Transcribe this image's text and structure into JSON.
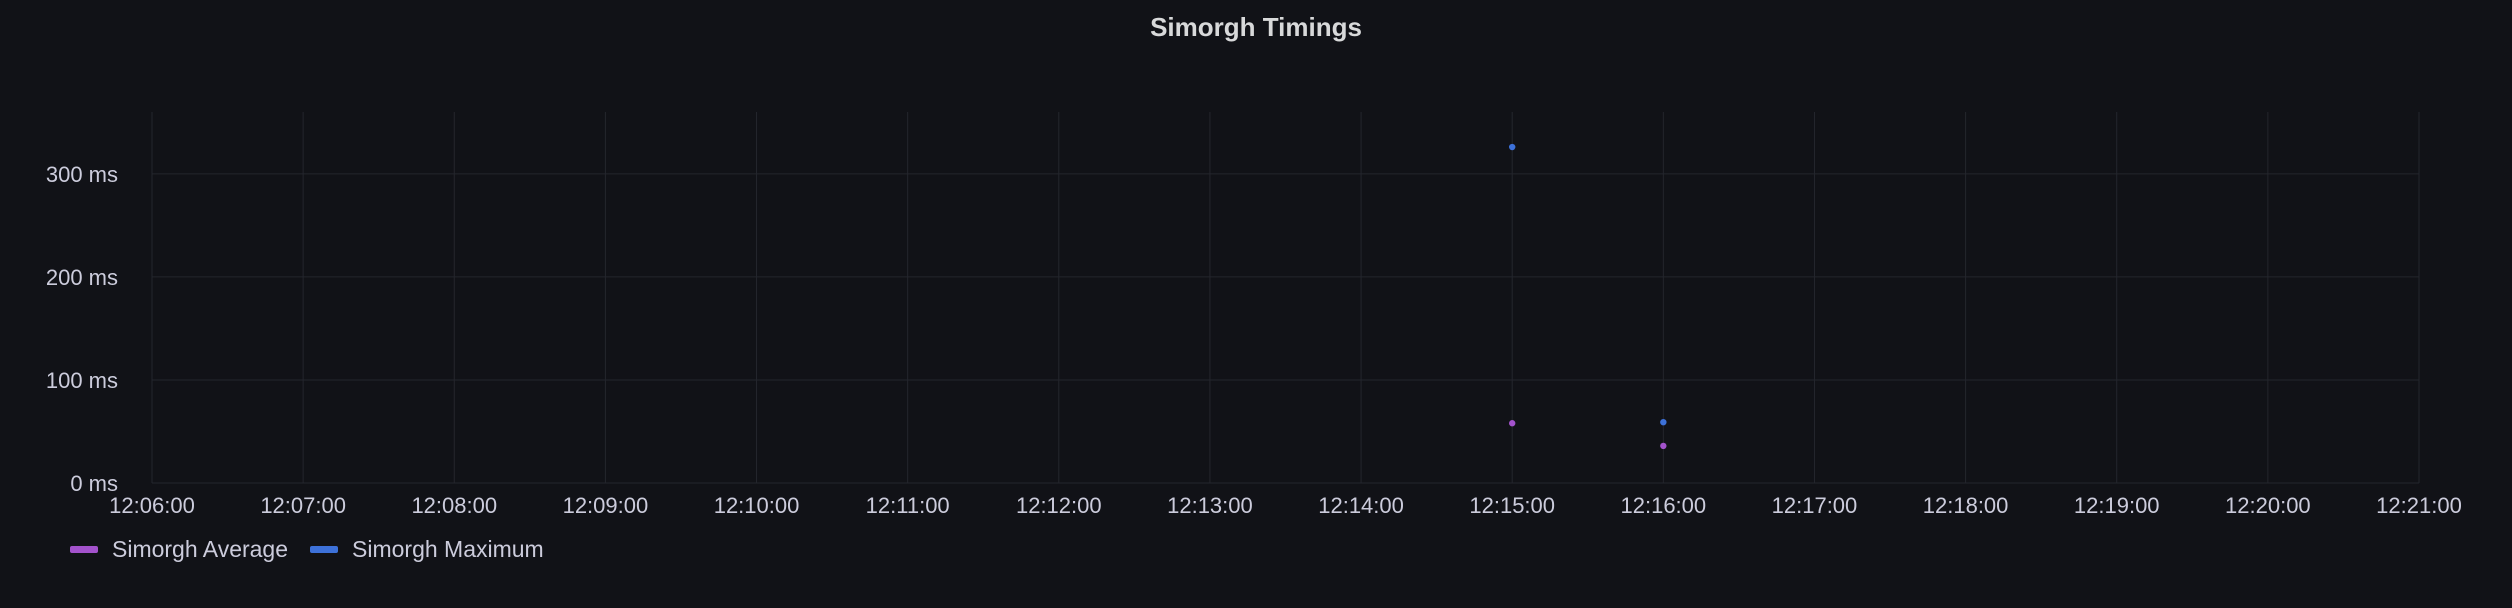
{
  "panel": {
    "title": "Simorgh Timings"
  },
  "chart_data": {
    "type": "scatter",
    "title": "Simorgh Timings",
    "xlabel": "",
    "ylabel": "",
    "x_ticks": [
      "12:06:00",
      "12:07:00",
      "12:08:00",
      "12:09:00",
      "12:10:00",
      "12:11:00",
      "12:12:00",
      "12:13:00",
      "12:14:00",
      "12:15:00",
      "12:16:00",
      "12:17:00",
      "12:18:00",
      "12:19:00",
      "12:20:00",
      "12:21:00"
    ],
    "xlim": [
      "12:06:00",
      "12:21:00"
    ],
    "y_ticks": [
      0,
      100,
      200,
      300
    ],
    "y_tick_labels": [
      "0 ms",
      "100 ms",
      "200 ms",
      "300 ms"
    ],
    "ylim": [
      0,
      360
    ],
    "y_unit": "ms",
    "grid": true,
    "legend_position": "bottom-left",
    "series": [
      {
        "name": "Simorgh Average",
        "color": "#a352cc",
        "points": [
          {
            "x": "12:15:00",
            "y": 58
          },
          {
            "x": "12:16:00",
            "y": 36
          }
        ]
      },
      {
        "name": "Simorgh Maximum",
        "color": "#3d71d9",
        "points": [
          {
            "x": "12:15:00",
            "y": 326
          },
          {
            "x": "12:16:00",
            "y": 59
          }
        ]
      }
    ]
  },
  "legend": {
    "items": [
      {
        "label": "Simorgh Average",
        "color": "#a352cc"
      },
      {
        "label": "Simorgh Maximum",
        "color": "#3d71d9"
      }
    ]
  },
  "colors": {
    "background": "#111217",
    "grid": "#24262d",
    "text": "#ccccdc"
  }
}
